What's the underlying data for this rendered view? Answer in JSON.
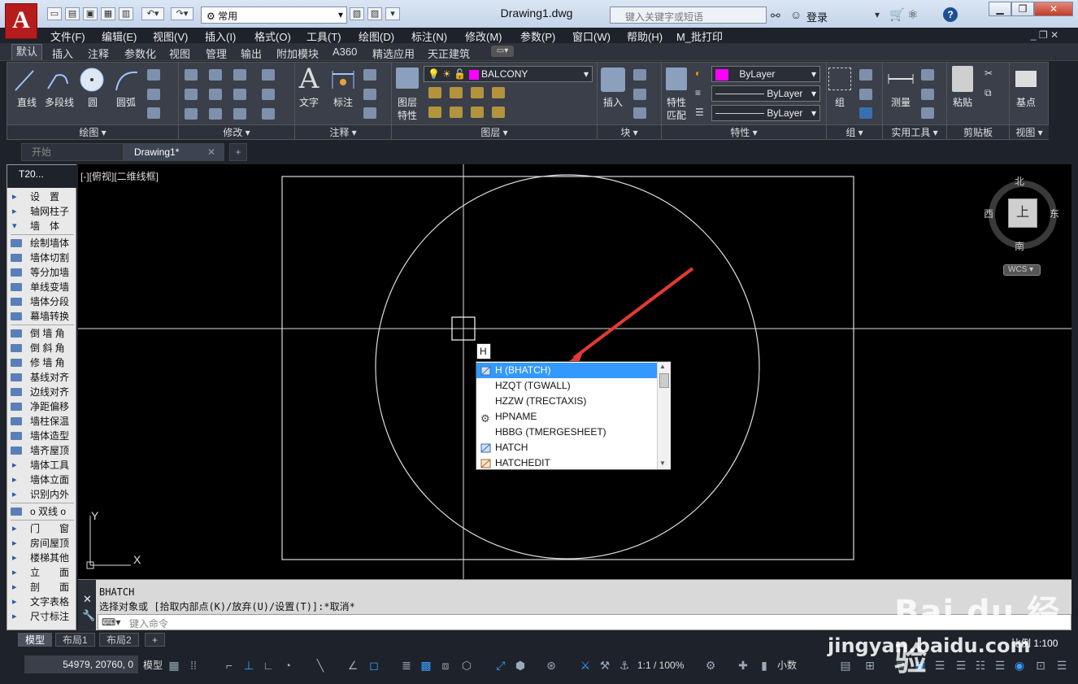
{
  "title_bar": {
    "logo_letter": "A",
    "workspace": "常用",
    "doc_title": "Drawing1.dwg",
    "search_placeholder": "键入关键字或短语",
    "login": "登录"
  },
  "menubar": [
    "文件(F)",
    "编辑(E)",
    "视图(V)",
    "插入(I)",
    "格式(O)",
    "工具(T)",
    "绘图(D)",
    "标注(N)",
    "修改(M)",
    "参数(P)",
    "窗口(W)",
    "帮助(H)",
    "M_批打印"
  ],
  "ribbon_tabs": [
    "默认",
    "插入",
    "注释",
    "参数化",
    "视图",
    "管理",
    "输出",
    "附加模块",
    "A360",
    "精选应用",
    "天正建筑"
  ],
  "ribbon": {
    "draw": {
      "line": "直线",
      "polyline": "多段线",
      "circle": "圆",
      "arc": "圆弧",
      "title": "绘图 ▾"
    },
    "modify": {
      "title": "修改 ▾"
    },
    "annotate": {
      "text": "文字",
      "dim": "标注",
      "title": "注释 ▾"
    },
    "layers": {
      "props": "图层",
      "props2": "特性",
      "current": "BALCONY",
      "title": "图层 ▾"
    },
    "block": {
      "insert": "插入",
      "title": "块 ▾"
    },
    "properties": {
      "match": "特性",
      "match2": "匹配",
      "color": "ByLayer",
      "linetype": "ByLayer",
      "lineweight": "ByLayer",
      "title": "特性 ▾"
    },
    "groups": {
      "group": "组",
      "title": "组 ▾"
    },
    "utilities": {
      "measure": "测量",
      "title": "实用工具 ▾"
    },
    "clipboard": {
      "paste": "粘贴",
      "title": "剪贴板"
    },
    "view": {
      "base": "基点",
      "title": "视图 ▾"
    }
  },
  "doc_tabs": {
    "start": "开始",
    "drawing": "Drawing1*"
  },
  "palette": {
    "header": "T20...",
    "items": [
      {
        "label": "设　置",
        "type": "tri"
      },
      {
        "label": "轴网柱子",
        "type": "tri"
      },
      {
        "label": "墙　体",
        "type": "open"
      },
      {
        "label": "绘制墙体",
        "type": "ico"
      },
      {
        "label": "墙体切割",
        "type": "ico"
      },
      {
        "label": "等分加墙",
        "type": "ico"
      },
      {
        "label": "单线变墙",
        "type": "ico"
      },
      {
        "label": "墙体分段",
        "type": "ico"
      },
      {
        "label": "幕墙转换",
        "type": "ico"
      },
      {
        "label": "倒 墙 角",
        "type": "ico"
      },
      {
        "label": "倒 斜 角",
        "type": "ico"
      },
      {
        "label": "修 墙 角",
        "type": "ico"
      },
      {
        "label": "基线对齐",
        "type": "ico"
      },
      {
        "label": "边线对齐",
        "type": "ico"
      },
      {
        "label": "净距偏移",
        "type": "ico"
      },
      {
        "label": "墙柱保温",
        "type": "ico"
      },
      {
        "label": "墙体造型",
        "type": "ico"
      },
      {
        "label": "墙齐屋顶",
        "type": "ico"
      },
      {
        "label": "墙体工具",
        "type": "tri"
      },
      {
        "label": "墙体立面",
        "type": "tri"
      },
      {
        "label": "识别内外",
        "type": "tri"
      },
      {
        "label": "o 双线 o",
        "type": "ico"
      },
      {
        "label": "门　　窗",
        "type": "tri"
      },
      {
        "label": "房间屋顶",
        "type": "tri"
      },
      {
        "label": "楼梯其他",
        "type": "tri"
      },
      {
        "label": "立　　面",
        "type": "tri"
      },
      {
        "label": "剖　　面",
        "type": "tri"
      },
      {
        "label": "文字表格",
        "type": "tri"
      },
      {
        "label": "尺寸标注",
        "type": "tri"
      }
    ]
  },
  "canvas": {
    "viewport_label": "[-][俯视][二维线框]",
    "viewcube": {
      "north": "北",
      "south": "南",
      "east": "东",
      "west": "西",
      "top": "上",
      "wcs": "WCS"
    },
    "ucs": {
      "x": "X",
      "y": "Y"
    },
    "typed": "H",
    "autocomplete": [
      {
        "label": "H (BHATCH)",
        "icon": "hatch-icon",
        "selected": true
      },
      {
        "label": "HZQT (TGWALL)",
        "icon": ""
      },
      {
        "label": "HZZW (TRECTAXIS)",
        "icon": ""
      },
      {
        "label": "HPNAME",
        "icon": "gear-icon"
      },
      {
        "label": "HBBG (TMERGESHEET)",
        "icon": ""
      },
      {
        "label": "HATCH",
        "icon": "hatch-icon"
      },
      {
        "label": "HATCHEDIT",
        "icon": "hatchedit-icon"
      }
    ]
  },
  "command": {
    "history1": "BHATCH",
    "history2": "选择对象或 [拾取内部点(K)/放弃(U)/设置(T)]:*取消*",
    "placeholder": "键入命令"
  },
  "layout_tabs": [
    "模型",
    "布局1",
    "布局2"
  ],
  "status": {
    "coords": "54979, 20760, 0",
    "model": "模型",
    "scale_ratio": "1:1 / 100%",
    "units": "小数",
    "drawing_scale": "比例 1:100"
  },
  "watermark": {
    "brand": "Bai du 经验",
    "url": "jingyan.baidu.com"
  },
  "colors": {
    "accent": "#3399ff",
    "arrow": "#e53935",
    "layer_swatch": "#ff00ff"
  }
}
